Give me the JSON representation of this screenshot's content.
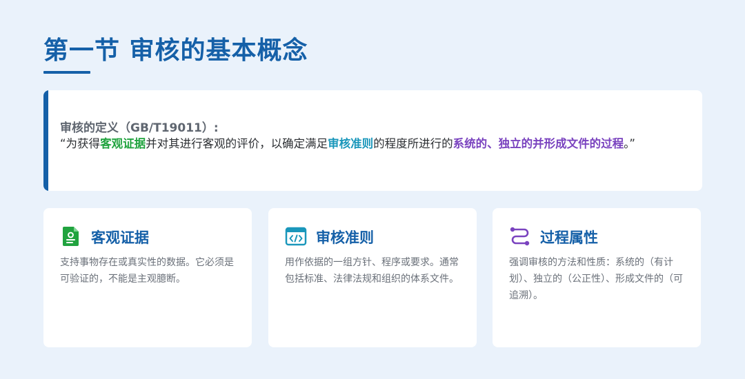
{
  "title": "第一节 审核的基本概念",
  "definition": {
    "heading": "审核的定义（GB/T19011）:",
    "segments": [
      {
        "text": "“为获得",
        "style": ""
      },
      {
        "text": "客观证据",
        "style": "green"
      },
      {
        "text": "并对其进行客观的评价，以确定满足",
        "style": ""
      },
      {
        "text": "审核准则",
        "style": "teal"
      },
      {
        "text": "的程度所进行的",
        "style": ""
      },
      {
        "text": "系统的、独立的并形成文件的过程",
        "style": "purple"
      },
      {
        "text": "。”",
        "style": ""
      }
    ]
  },
  "cards": [
    {
      "icon": "document-icon",
      "title": "客观证据",
      "text": "支持事物存在或真实性的数据。它必须是可验证的，不能是主观臆断。"
    },
    {
      "icon": "code-window-icon",
      "title": "审核准则",
      "text": "用作依据的一组方针、程序或要求。通常包括标准、法律法规和组织的体系文件。"
    },
    {
      "icon": "route-icon",
      "title": "过程属性",
      "text": "强调审核的方法和性质：系统的（有计划）、独立的（公正性）、形成文件的（可追溯）。"
    }
  ],
  "colors": {
    "primary": "#1560a8",
    "green": "#21a33f",
    "teal": "#1a97bb",
    "purple": "#7a43bf",
    "background": "#eaf2fb"
  }
}
